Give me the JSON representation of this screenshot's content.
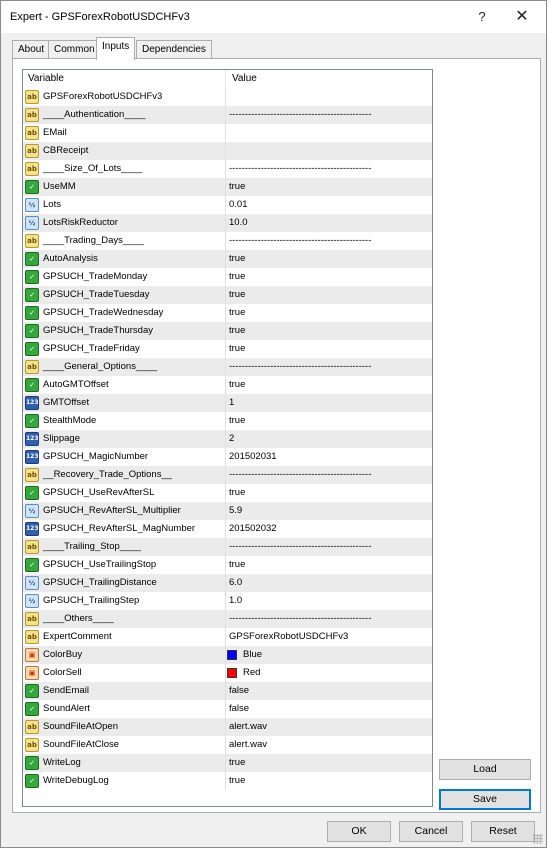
{
  "window": {
    "title": "Expert - GPSForexRobotUSDCHFv3",
    "help_label": "?",
    "close_label": "✕"
  },
  "tabs": [
    "About",
    "Common",
    "Inputs",
    "Dependencies"
  ],
  "active_tab": "Inputs",
  "grid": {
    "header_variable": "Variable",
    "header_value": "Value",
    "rows": [
      {
        "type": "ab",
        "name": "GPSForexRobotUSDCHFv3",
        "value": ""
      },
      {
        "type": "ab",
        "name": "____Authentication____",
        "value": "---------------------------------------------"
      },
      {
        "type": "ab",
        "name": "EMail",
        "value": ""
      },
      {
        "type": "ab",
        "name": "CBReceipt",
        "value": ""
      },
      {
        "type": "ab",
        "name": "____Size_Of_Lots____",
        "value": "---------------------------------------------"
      },
      {
        "type": "bool",
        "name": "UseMM",
        "value": "true"
      },
      {
        "type": "dbl",
        "name": "Lots",
        "value": "0.01"
      },
      {
        "type": "dbl",
        "name": "LotsRiskReductor",
        "value": "10.0"
      },
      {
        "type": "ab",
        "name": "____Trading_Days____",
        "value": "---------------------------------------------"
      },
      {
        "type": "bool",
        "name": "AutoAnalysis",
        "value": "true"
      },
      {
        "type": "bool",
        "name": "GPSUCH_TradeMonday",
        "value": "true"
      },
      {
        "type": "bool",
        "name": "GPSUCH_TradeTuesday",
        "value": "true"
      },
      {
        "type": "bool",
        "name": "GPSUCH_TradeWednesday",
        "value": "true"
      },
      {
        "type": "bool",
        "name": "GPSUCH_TradeThursday",
        "value": "true"
      },
      {
        "type": "bool",
        "name": "GPSUCH_TradeFriday",
        "value": "true"
      },
      {
        "type": "ab",
        "name": "____General_Options____",
        "value": "---------------------------------------------"
      },
      {
        "type": "bool",
        "name": "AutoGMTOffset",
        "value": "true"
      },
      {
        "type": "int",
        "name": "GMTOffset",
        "value": "1"
      },
      {
        "type": "bool",
        "name": "StealthMode",
        "value": "true"
      },
      {
        "type": "int",
        "name": "Slippage",
        "value": "2"
      },
      {
        "type": "int",
        "name": "GPSUCH_MagicNumber",
        "value": "201502031"
      },
      {
        "type": "ab",
        "name": "__Recovery_Trade_Options__",
        "value": "---------------------------------------------"
      },
      {
        "type": "bool",
        "name": "GPSUCH_UseRevAfterSL",
        "value": "true"
      },
      {
        "type": "dbl",
        "name": "GPSUCH_RevAfterSL_Multiplier",
        "value": "5.9"
      },
      {
        "type": "int",
        "name": "GPSUCH_RevAfterSL_MagNumber",
        "value": "201502032"
      },
      {
        "type": "ab",
        "name": "____Trailing_Stop____",
        "value": "---------------------------------------------"
      },
      {
        "type": "bool",
        "name": "GPSUCH_UseTrailingStop",
        "value": "true"
      },
      {
        "type": "dbl",
        "name": "GPSUCH_TrailingDistance",
        "value": "6.0"
      },
      {
        "type": "dbl",
        "name": "GPSUCH_TrailingStep",
        "value": "1.0"
      },
      {
        "type": "ab",
        "name": "____Others____",
        "value": "---------------------------------------------"
      },
      {
        "type": "ab",
        "name": "ExpertComment",
        "value": "GPSForexRobotUSDCHFv3"
      },
      {
        "type": "clr",
        "name": "ColorBuy",
        "value": "Blue",
        "swatch": "#0000ff"
      },
      {
        "type": "clr",
        "name": "ColorSell",
        "value": "Red",
        "swatch": "#ff0000"
      },
      {
        "type": "bool",
        "name": "SendEmail",
        "value": "false"
      },
      {
        "type": "bool",
        "name": "SoundAlert",
        "value": "false"
      },
      {
        "type": "ab",
        "name": "SoundFileAtOpen",
        "value": "alert.wav"
      },
      {
        "type": "ab",
        "name": "SoundFileAtClose",
        "value": "alert.wav"
      },
      {
        "type": "bool",
        "name": "WriteLog",
        "value": "true"
      },
      {
        "type": "bool",
        "name": "WriteDebugLog",
        "value": "true"
      }
    ]
  },
  "icons": {
    "ab": "ab",
    "bool": "✓",
    "dbl": "½",
    "int": "123",
    "clr": "▣"
  },
  "side_buttons": {
    "load": "Load",
    "save": "Save"
  },
  "footer_buttons": {
    "ok": "OK",
    "cancel": "Cancel",
    "reset": "Reset"
  }
}
